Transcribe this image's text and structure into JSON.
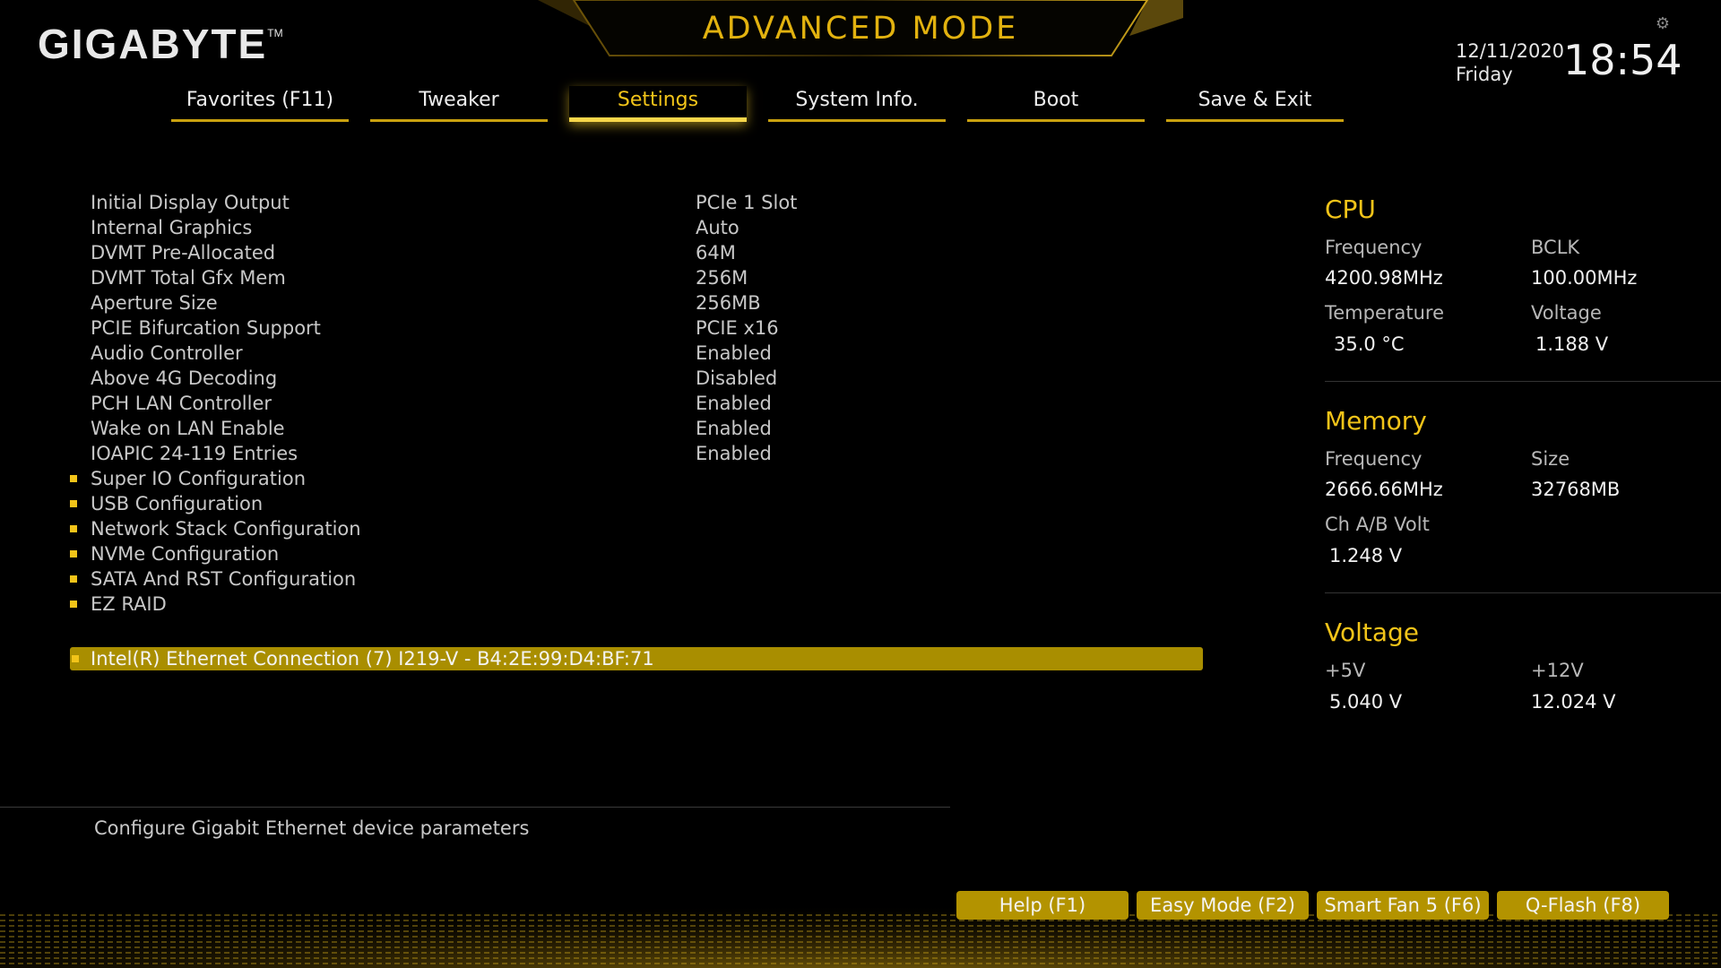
{
  "header": {
    "brand": "GIGABYTE",
    "brand_tm": "TM",
    "mode_title": "ADVANCED MODE",
    "date": "12/11/2020",
    "day": "Friday",
    "time": "18:54",
    "accent_color": "#f2c419"
  },
  "tabs": [
    {
      "label": "Favorites (F11)",
      "active": false
    },
    {
      "label": "Tweaker",
      "active": false
    },
    {
      "label": "Settings",
      "active": true
    },
    {
      "label": "System Info.",
      "active": false
    },
    {
      "label": "Boot",
      "active": false
    },
    {
      "label": "Save & Exit",
      "active": false
    }
  ],
  "settings": [
    {
      "label": "Initial Display Output",
      "value": "PCIe 1 Slot"
    },
    {
      "label": "Internal Graphics",
      "value": "Auto"
    },
    {
      "label": "DVMT Pre-Allocated",
      "value": "64M"
    },
    {
      "label": "DVMT Total Gfx Mem",
      "value": "256M"
    },
    {
      "label": "Aperture Size",
      "value": "256MB"
    },
    {
      "label": "PCIE Bifurcation Support",
      "value": "PCIE x16"
    },
    {
      "label": "Audio Controller",
      "value": "Enabled"
    },
    {
      "label": "Above 4G Decoding",
      "value": "Disabled"
    },
    {
      "label": "PCH LAN Controller",
      "value": "Enabled"
    },
    {
      "label": "Wake on LAN Enable",
      "value": "Enabled"
    },
    {
      "label": "IOAPIC 24-119 Entries",
      "value": "Enabled"
    }
  ],
  "submenus": [
    {
      "label": "Super IO Configuration"
    },
    {
      "label": "USB Configuration"
    },
    {
      "label": "Network Stack Configuration"
    },
    {
      "label": "NVMe Configuration"
    },
    {
      "label": "SATA And RST Configuration"
    },
    {
      "label": "EZ RAID"
    }
  ],
  "selected_item": {
    "label": "Intel(R) Ethernet Connection (7) I219-V - B4:2E:99:D4:BF:71"
  },
  "help_text": "Configure Gigabit Ethernet device parameters",
  "cpu": {
    "title": "CPU",
    "frequency_label": "Frequency",
    "frequency": "4200.98MHz",
    "bclk_label": "BCLK",
    "bclk": "100.00MHz",
    "temperature_label": "Temperature",
    "temperature": "35.0 °C",
    "voltage_label": "Voltage",
    "voltage": "1.188 V"
  },
  "memory": {
    "title": "Memory",
    "frequency_label": "Frequency",
    "frequency": "2666.66MHz",
    "size_label": "Size",
    "size": "32768MB",
    "volt_label": "Ch A/B Volt",
    "volt": "1.248 V"
  },
  "voltage": {
    "title": "Voltage",
    "v5_label": "+5V",
    "v5": "5.040 V",
    "v12_label": "+12V",
    "v12": "12.024 V"
  },
  "buttons": [
    {
      "label": "Help (F1)"
    },
    {
      "label": "Easy Mode (F2)"
    },
    {
      "label": "Smart Fan 5 (F6)"
    },
    {
      "label": "Q-Flash (F8)"
    }
  ]
}
